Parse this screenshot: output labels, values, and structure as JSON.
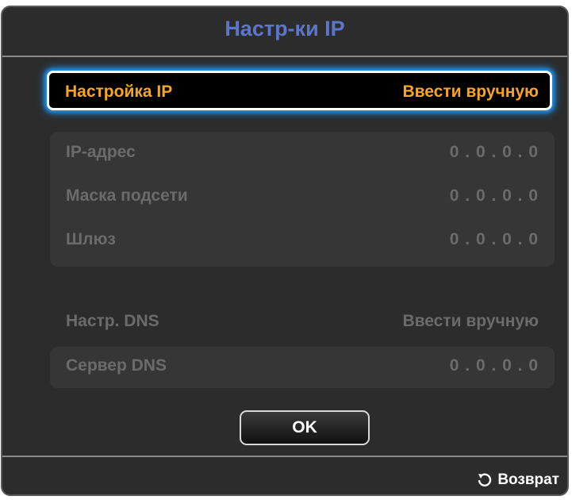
{
  "dialog": {
    "title": "Настр-ки IP",
    "ip_setting": {
      "label": "Настройка IP",
      "value": "Ввести вручную"
    },
    "ip_fields": [
      {
        "label": "IP-адрес",
        "value": "0 . 0 . 0 . 0"
      },
      {
        "label": "Маска подсети",
        "value": "0 . 0 . 0 . 0"
      },
      {
        "label": "Шлюз",
        "value": "0 . 0 . 0 . 0"
      }
    ],
    "dns_setting": {
      "label": "Настр. DNS",
      "value": "Ввести вручную"
    },
    "dns_server": {
      "label": "Сервер DNS",
      "value": "0 . 0 . 0 . 0"
    },
    "ok_label": "OK",
    "return_label": "Возврат",
    "return_icon": "return-arrow-icon"
  },
  "colors": {
    "title": "#5c76c9",
    "selected_text": "#f6a623",
    "focus_glow": "#1f8ce0",
    "disabled_text": "#6b6b6b",
    "panel_bg": "#2c2c2c"
  }
}
